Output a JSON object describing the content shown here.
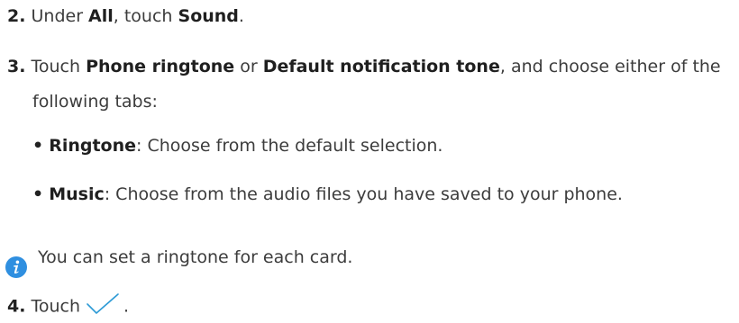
{
  "steps": {
    "step2": {
      "number": "2.",
      "p1": " Under ",
      "b1": "All",
      "p2": ", touch ",
      "b2": "Sound",
      "p3": "."
    },
    "step3": {
      "number": "3.",
      "p1": " Touch ",
      "b1": "Phone ringtone",
      "p2": " or ",
      "b2": "Default notification tone",
      "p3": ", and choose either of the",
      "line2": "following tabs:"
    },
    "bullets": [
      {
        "symbol": "•",
        "label": "Ringtone",
        "text": ": Choose from the default selection."
      },
      {
        "symbol": "•",
        "label": "Music",
        "text": ": Choose from the audio files you have saved to your phone."
      }
    ],
    "note": {
      "icon": "info-icon",
      "text": "You can set a ringtone for each card."
    },
    "step4": {
      "number": "4.",
      "p1": " Touch",
      "icon": "checkmark-icon",
      "p2": "."
    }
  },
  "colors": {
    "info_icon": "#2f8fe0",
    "checkmark": "#2e9bd6"
  }
}
